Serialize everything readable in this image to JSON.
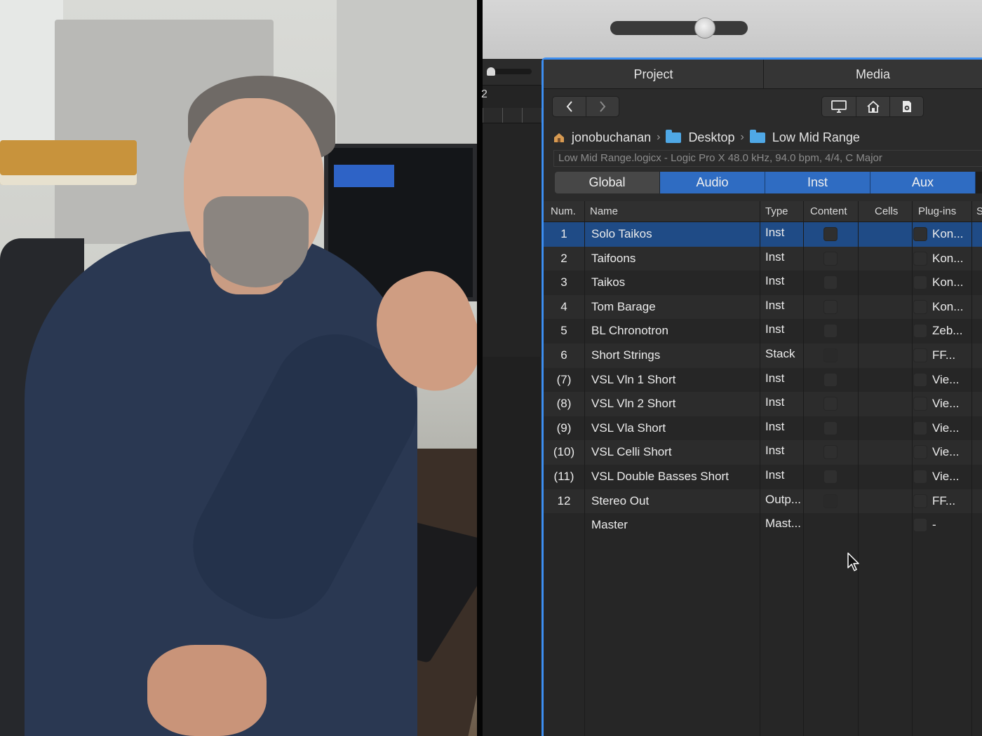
{
  "browser": {
    "tabs": {
      "project": "Project",
      "media": "Media"
    },
    "path": [
      {
        "icon": "home-folder-icon",
        "label": "jonobuchanan"
      },
      {
        "icon": "folder-icon",
        "label": "Desktop"
      },
      {
        "icon": "folder-icon",
        "label": "Low Mid Range"
      }
    ],
    "info": "Low Mid Range.logicx - Logic Pro X 48.0 kHz, 94.0 bpm, 4/4, C Major",
    "filters": [
      {
        "label": "Global",
        "active": false
      },
      {
        "label": "Audio",
        "active": true
      },
      {
        "label": "Inst",
        "active": true
      },
      {
        "label": "Aux",
        "active": true
      }
    ],
    "columns": {
      "num": "Num.",
      "name": "Name",
      "type": "Type",
      "content": "Content",
      "cells": "Cells",
      "plugins": "Plug-ins",
      "extra": "S"
    },
    "rows": [
      {
        "num": "1",
        "name": "Solo Taikos",
        "type": "Inst",
        "plugin": "Kon..."
      },
      {
        "num": "2",
        "name": "Taifoons",
        "type": "Inst",
        "plugin": "Kon..."
      },
      {
        "num": "3",
        "name": "Taikos",
        "type": "Inst",
        "plugin": "Kon..."
      },
      {
        "num": "4",
        "name": "Tom Barage",
        "type": "Inst",
        "plugin": "Kon..."
      },
      {
        "num": "5",
        "name": "BL Chronotron",
        "type": "Inst",
        "plugin": "Zeb..."
      },
      {
        "num": "6",
        "name": "Short Strings",
        "type": "Stack",
        "plugin": "FF..."
      },
      {
        "num": "(7)",
        "name": "VSL Vln 1 Short",
        "type": "Inst",
        "plugin": "Vie..."
      },
      {
        "num": "(8)",
        "name": "VSL Vln 2 Short",
        "type": "Inst",
        "plugin": "Vie..."
      },
      {
        "num": "(9)",
        "name": "VSL Vla Short",
        "type": "Inst",
        "plugin": "Vie..."
      },
      {
        "num": "(10)",
        "name": "VSL Celli Short",
        "type": "Inst",
        "plugin": "Vie..."
      },
      {
        "num": "(11)",
        "name": "VSL Double Basses Short",
        "type": "Inst",
        "plugin": "Vie..."
      },
      {
        "num": "12",
        "name": "Stereo Out",
        "type": "Outp...",
        "plugin": "FF..."
      },
      {
        "num": "",
        "name": "Master",
        "type": "Mast...",
        "plugin": "-"
      }
    ]
  },
  "side": {
    "track_number": "2"
  },
  "colors": {
    "accent": "#3d8ef0",
    "selected_row": "#1f4b86",
    "filter_on": "#2f6cc2",
    "folder": "#4fa8e6"
  }
}
